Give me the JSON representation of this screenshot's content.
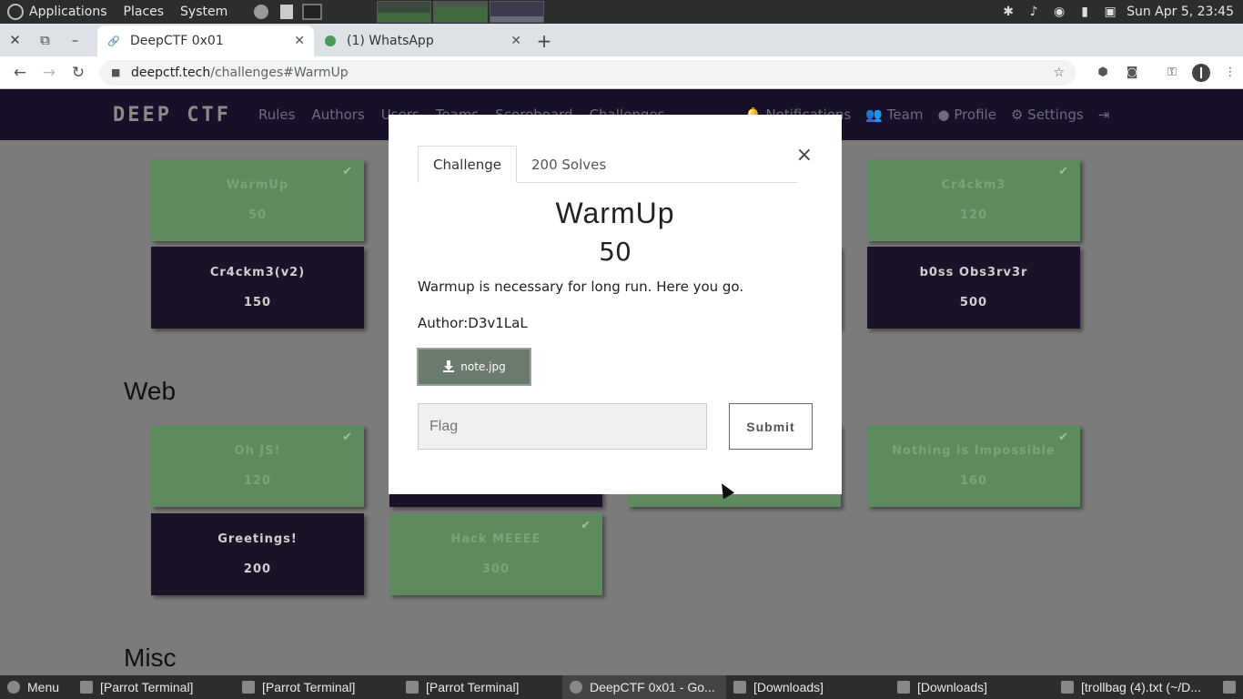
{
  "os_panel": {
    "menus": [
      "Applications",
      "Places",
      "System"
    ],
    "clock": "Sun Apr  5, 23:45"
  },
  "browser": {
    "tabs": [
      {
        "label": "DeepCTF 0x01",
        "active": true
      },
      {
        "label": "(1) WhatsApp",
        "active": false
      }
    ],
    "url_host": "deepctf.tech",
    "url_path": "/challenges#WarmUp"
  },
  "site": {
    "brand": "DEEP CTF",
    "nav_links": [
      "Rules",
      "Authors",
      "Users",
      "Teams",
      "Scoreboard",
      "Challenges"
    ],
    "nav_right": [
      "Notifications",
      "Team",
      "Profile",
      "Settings"
    ]
  },
  "cards": [
    {
      "name": "WarmUp",
      "value": "50",
      "solved": true
    },
    {
      "name": "Cr4ckm3",
      "value": "120",
      "solved": true
    },
    {
      "name": "Cr4ckm3(v2)",
      "value": "150",
      "solved": false
    },
    {
      "name": "b0ss Obs3rv3r",
      "value": "500",
      "solved": false
    },
    {
      "name": "Oh JS!",
      "value": "120",
      "solved": true
    },
    {
      "name": "Nothing is Impossible",
      "value": "160",
      "solved": true
    },
    {
      "name": "Greetings!",
      "value": "200",
      "solved": false
    },
    {
      "name": "Hack MEEEE",
      "value": "300",
      "solved": true
    }
  ],
  "sections": [
    "Web",
    "Misc"
  ],
  "modal": {
    "tab_challenge": "Challenge",
    "tab_solves": "200 Solves",
    "close": "×",
    "title": "WarmUp",
    "value": "50",
    "description": "Warmup is necessary for long run. Here you go.",
    "author": "Author:D3v1LaL",
    "file": "note.jpg",
    "flag_placeholder": "Flag",
    "submit": "Submit"
  },
  "taskbar": {
    "menu": "Menu",
    "items": [
      "[Parrot Terminal]",
      "[Parrot Terminal]",
      "[Parrot Terminal]",
      "DeepCTF 0x01 - Go...",
      "[Downloads]",
      "[Downloads]",
      "[trollbag (4).txt (~/D..."
    ]
  }
}
